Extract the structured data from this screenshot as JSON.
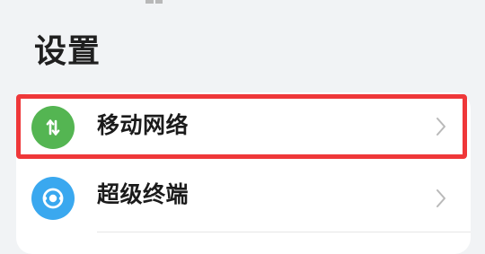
{
  "page": {
    "title": "设置"
  },
  "settings": {
    "items": [
      {
        "label": "移动网络",
        "icon": "mobile-data-icon",
        "icon_color": "#54b552"
      },
      {
        "label": "超级终端",
        "icon": "super-device-icon",
        "icon_color": "#3aa8ef"
      }
    ]
  },
  "annotation": {
    "highlight_color": "#ef3739",
    "highlighted_item": "移动网络"
  }
}
